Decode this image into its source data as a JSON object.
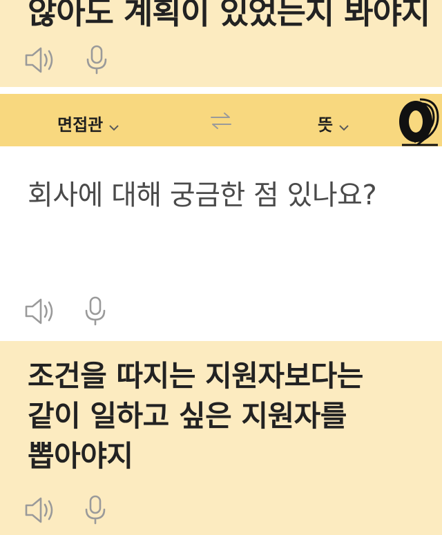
{
  "previous_result": {
    "text": "않아도 계획이 있었는지 봐야지"
  },
  "language_bar": {
    "source_language": "면접관",
    "target_language": "뜻"
  },
  "input": {
    "text": "회사에 대해 궁금한 점 있나요?"
  },
  "output": {
    "lines": [
      "조건을 따지는 지원자보다는",
      "같이 일하고 싶은 지원자를",
      "뽑아야지"
    ]
  },
  "icons": {
    "speaker": "speaker-icon",
    "microphone": "microphone-icon",
    "swap": "swap-arrows-icon",
    "chevron": "chevron-down-icon",
    "logo": "logo-icon"
  },
  "colors": {
    "language_bar": "#f8d87f",
    "result_background": "#fcebc0",
    "text": "#222222",
    "icon": "#9a9a9a"
  }
}
